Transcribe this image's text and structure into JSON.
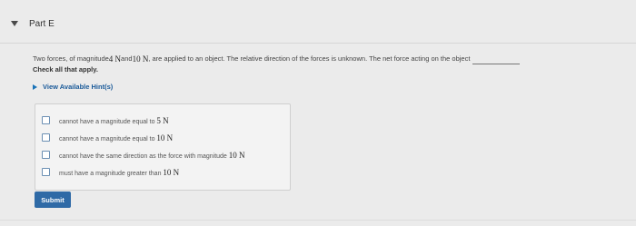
{
  "part": {
    "title": "Part E"
  },
  "question": {
    "text_1": "Two forces, of magnitude ",
    "value_1": "4 N",
    "text_2": " and ",
    "value_2": "10 N",
    "text_3": ", are applied to an object. The relative direction of the forces is unknown. The net force acting on the object"
  },
  "instruction": "Check all that apply.",
  "hint": {
    "label": "View Available Hint(s)"
  },
  "options": [
    {
      "text": "cannot have a magnitude equal to ",
      "value": "5 N"
    },
    {
      "text": "cannot have a magnitude equal to ",
      "value": "10 N"
    },
    {
      "text": "cannot have the same direction as the force with magnitude ",
      "value": "10 N"
    },
    {
      "text": "must have a magnitude greater than ",
      "value": "10 N"
    }
  ],
  "submit": {
    "label": "Submit"
  },
  "colors": {
    "background": "#ebebeb",
    "submit_button": "#2f6aa6",
    "link": "#1a5a99",
    "checkbox_border": "#6b8fb3"
  }
}
